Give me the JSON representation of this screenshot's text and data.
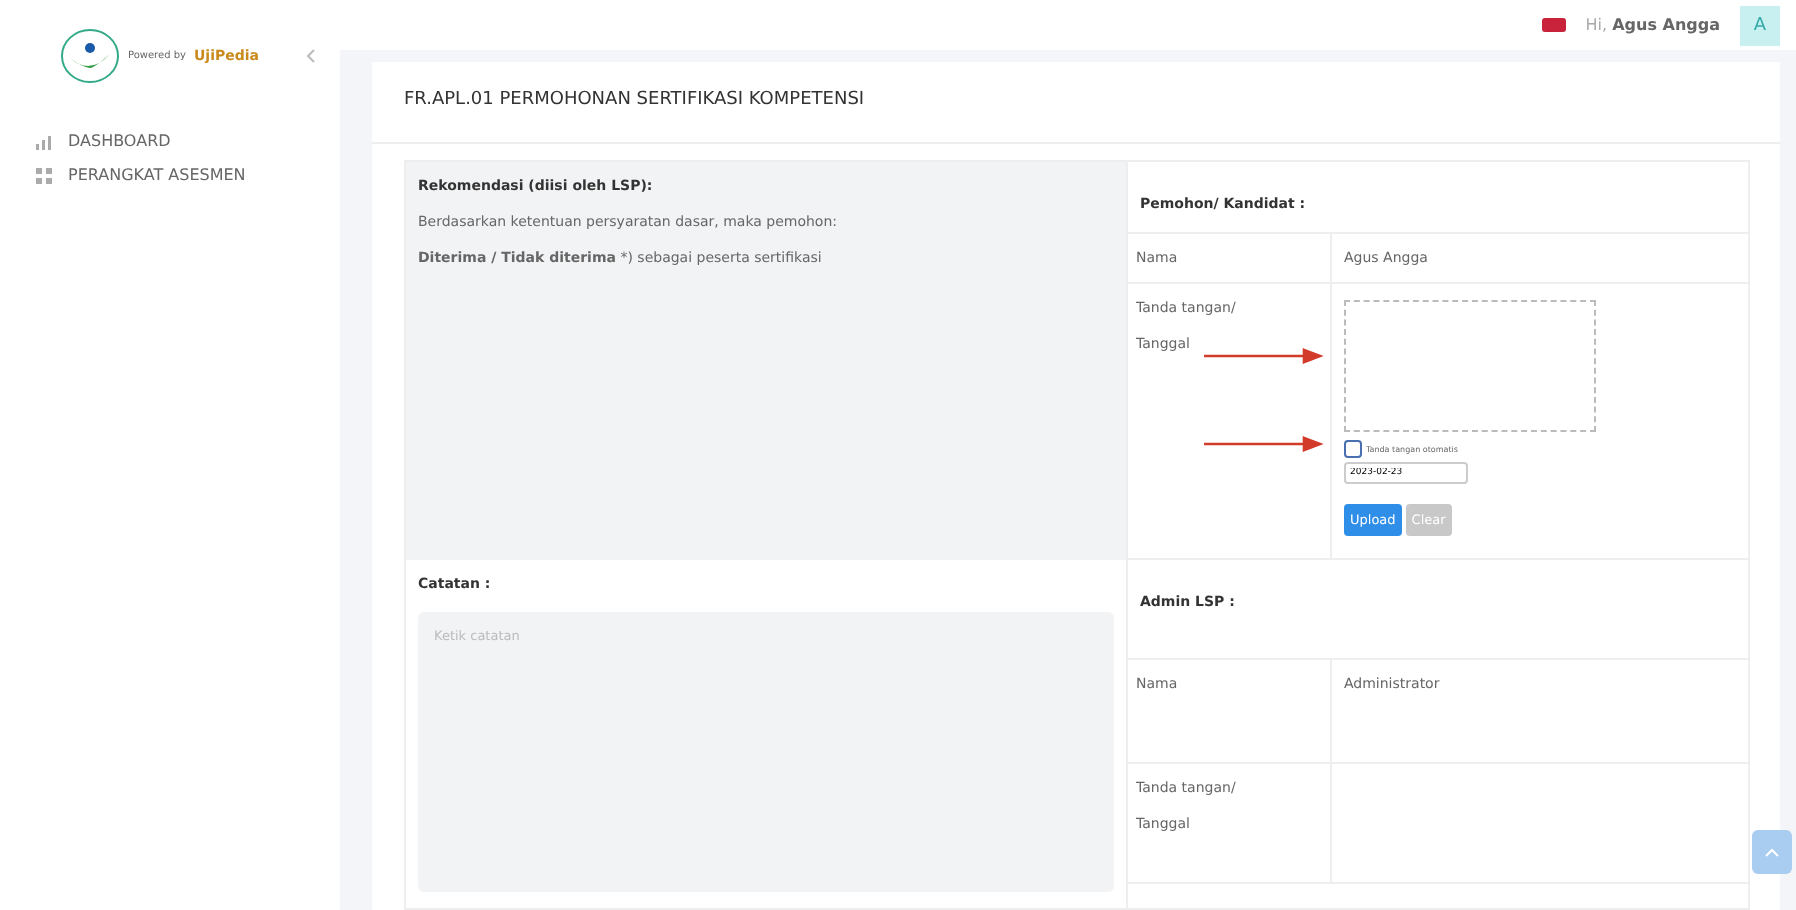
{
  "sidebar": {
    "logo_caption": "Powered by",
    "brand": "UjiPedia",
    "items": [
      {
        "label": "DASHBOARD",
        "selected": false
      },
      {
        "label": "PERANGKAT ASESMEN",
        "selected": false
      }
    ]
  },
  "topbar": {
    "greeting": "Hi,",
    "user": "Agus Angga",
    "avatar": "A"
  },
  "page_title": "FR.APL.01 PERMOHONAN SERTIFIKASI KOMPETENSI",
  "recommendation": {
    "title": "Rekomendasi (diisi oleh LSP):",
    "text": "Berdasarkan ketentuan persyaratan dasar, maka pemohon:",
    "decision": "**Diterima / Tidak diterima** *) sebagai peserta  sertifikasi"
  },
  "applicant": {
    "title": "Pemohon/ Kandidat :",
    "name_label": "Nama",
    "name": "Agus Angga",
    "sign_label": [
      "Tanda tangan/",
      "Tanggal"
    ],
    "auto_sign": {
      "label": "Tanda tangan otomatis",
      "checked": false
    },
    "date": "2023-02-23",
    "buttons": [
      {
        "label": "Upload",
        "disabled": false
      },
      {
        "label": "Clear",
        "disabled": true
      }
    ]
  },
  "notes": {
    "title": "Catatan :",
    "placeholder": "Ketik catatan"
  },
  "admin": {
    "title": "Admin LSP  :",
    "name_label": "Nama",
    "name": "Administrator",
    "sign_label": [
      "Tanda tangan/",
      "Tanggal"
    ]
  }
}
